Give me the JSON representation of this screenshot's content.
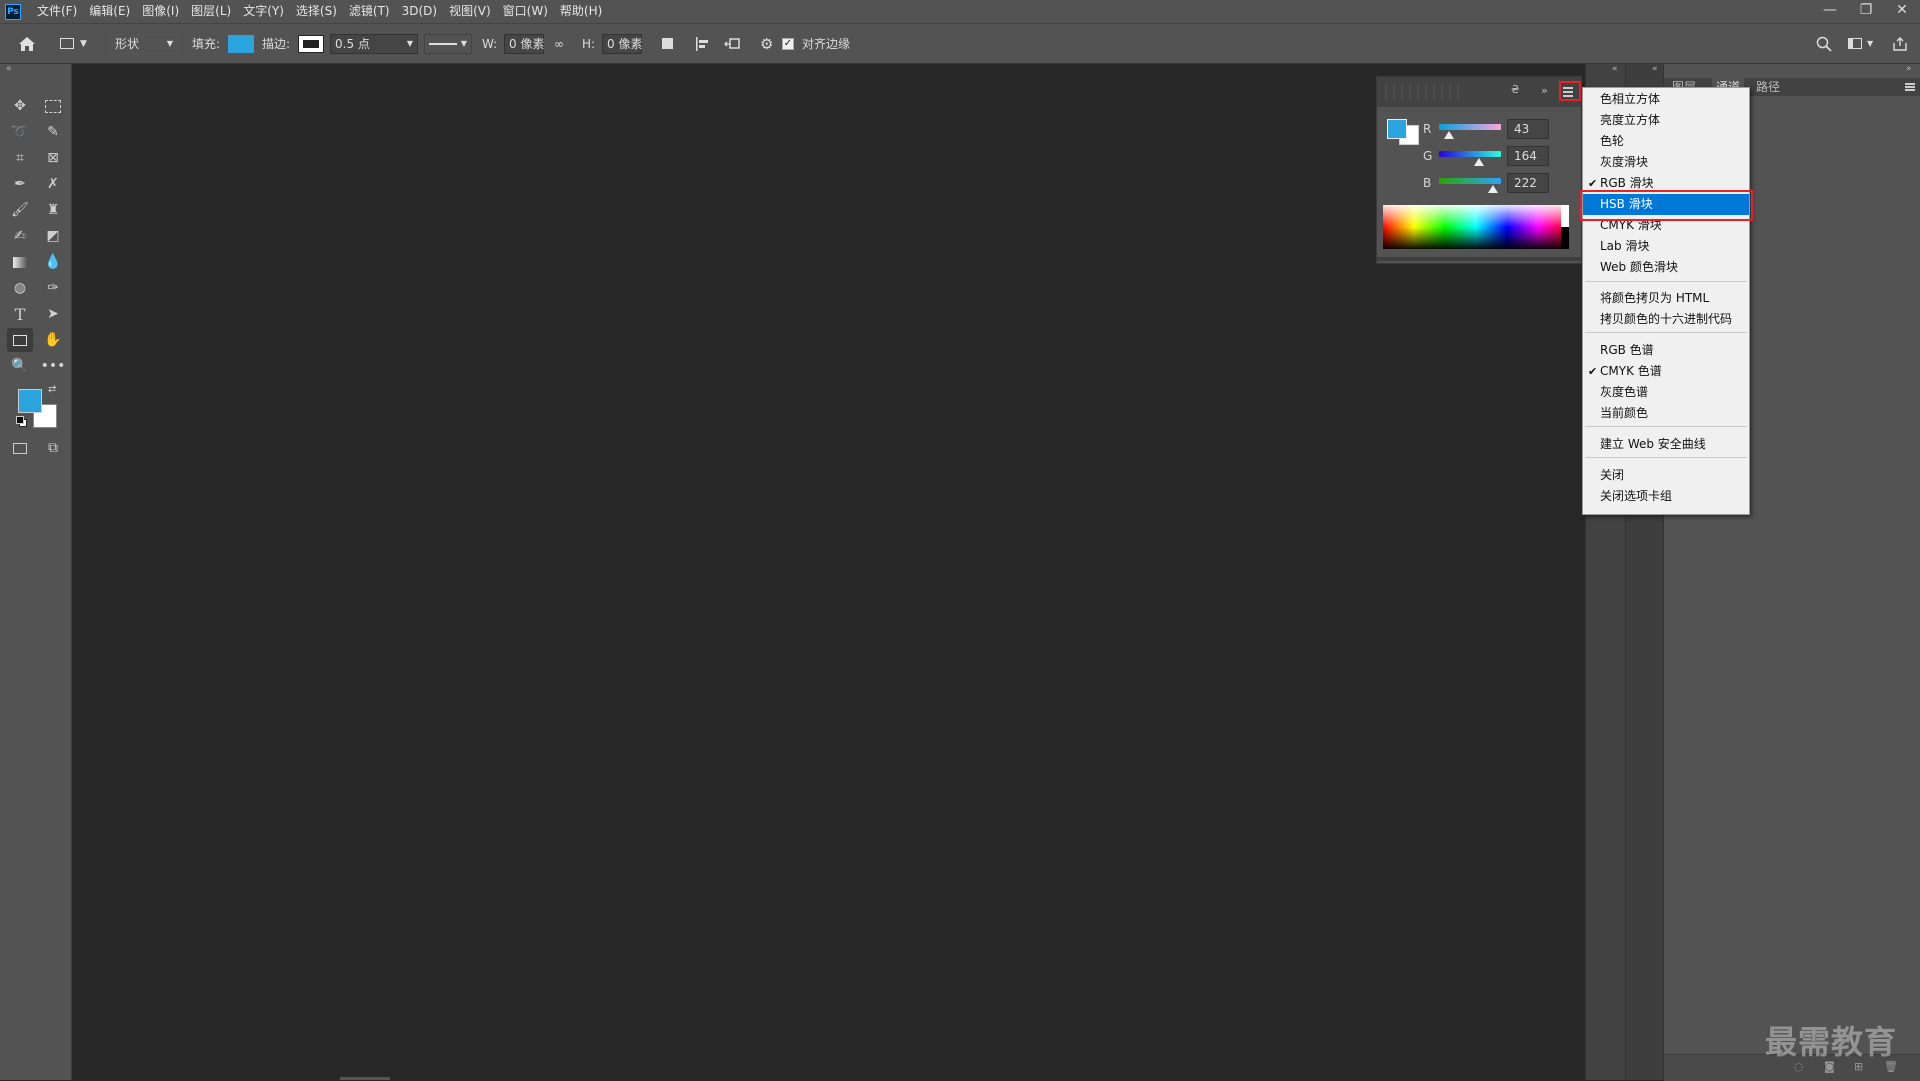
{
  "menubar": {
    "app_logo": "Ps",
    "items": [
      "文件(F)",
      "编辑(E)",
      "图像(I)",
      "图层(L)",
      "文字(Y)",
      "选择(S)",
      "滤镜(T)",
      "3D(D)",
      "视图(V)",
      "窗口(W)",
      "帮助(H)"
    ],
    "window_controls": {
      "minimize": "—",
      "restore": "❐",
      "close": "✕"
    }
  },
  "optionsbar": {
    "mode": "形状",
    "fill_label": "填充:",
    "fill_color": "#2ba4de",
    "stroke_label": "描边:",
    "stroke_width": "0.5 点",
    "w_label": "W:",
    "w_value": "0 像素",
    "h_label": "H:",
    "h_value": "0 像素",
    "align_edges_label": "对齐边缘",
    "align_edges_checked": true
  },
  "toolbar": {
    "foreground_color": "#2ba4de",
    "background_color": "#ffffff"
  },
  "color_panel": {
    "swatch": "#2ba4de",
    "channels": [
      {
        "label": "R",
        "value": "43",
        "fraction": 0.169
      },
      {
        "label": "G",
        "value": "164",
        "fraction": 0.643
      },
      {
        "label": "B",
        "value": "222",
        "fraction": 0.871
      }
    ]
  },
  "right_panel": {
    "tabs": [
      "图层",
      "通道",
      "路径"
    ]
  },
  "dropdown": {
    "items": [
      {
        "label": "色相立方体",
        "checked": false,
        "highlight": false
      },
      {
        "label": "亮度立方体",
        "checked": false,
        "highlight": false
      },
      {
        "label": "色轮",
        "checked": false,
        "highlight": false
      },
      {
        "label": "灰度滑块",
        "checked": false,
        "highlight": false
      },
      {
        "label": "RGB 滑块",
        "checked": true,
        "highlight": false
      },
      {
        "label": "HSB 滑块",
        "checked": false,
        "highlight": true
      },
      {
        "label": "CMYK 滑块",
        "checked": false,
        "highlight": false
      },
      {
        "label": "Lab 滑块",
        "checked": false,
        "highlight": false
      },
      {
        "label": "Web 颜色滑块",
        "checked": false,
        "highlight": false
      },
      {
        "label": "将颜色拷贝为 HTML",
        "checked": false,
        "highlight": false
      },
      {
        "label": "拷贝颜色的十六进制代码",
        "checked": false,
        "highlight": false
      },
      {
        "label": "RGB 色谱",
        "checked": false,
        "highlight": false
      },
      {
        "label": "CMYK 色谱",
        "checked": true,
        "highlight": false
      },
      {
        "label": "灰度色谱",
        "checked": false,
        "highlight": false
      },
      {
        "label": "当前颜色",
        "checked": false,
        "highlight": false
      },
      {
        "label": "建立 Web 安全曲线",
        "checked": false,
        "highlight": false
      },
      {
        "label": "关闭",
        "checked": false,
        "highlight": false
      },
      {
        "label": "关闭选项卡组",
        "checked": false,
        "highlight": false
      }
    ]
  },
  "watermark": "最需教育",
  "accent_color": "#0078d7",
  "highlight_box_color": "#e8202a"
}
